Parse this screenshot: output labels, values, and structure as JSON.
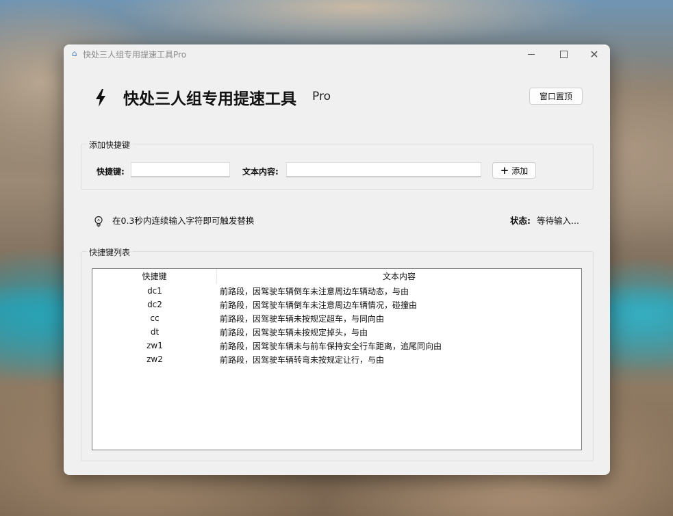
{
  "window": {
    "title": "快处三人组专用提速工具Pro"
  },
  "header": {
    "title": "快处三人组专用提速工具",
    "suffix": "Pro",
    "pin_button": "窗口置顶"
  },
  "add_group": {
    "label": "添加快捷键",
    "key_label": "快捷键:",
    "key_value": "",
    "text_label": "文本内容:",
    "text_value": "",
    "add_button": "添加"
  },
  "hint": {
    "text": "在0.3秒内连续输入字符即可触发替换",
    "status_label": "状态:",
    "status_value": "等待输入..."
  },
  "list_group": {
    "label": "快捷键列表",
    "columns": [
      "快捷键",
      "文本内容"
    ],
    "rows": [
      {
        "key": "dc1",
        "text": "前路段，因驾驶车辆倒车未注意周边车辆动态，与由"
      },
      {
        "key": "dc2",
        "text": "前路段，因驾驶车辆倒车未注意周边车辆情况，碰撞由"
      },
      {
        "key": "cc",
        "text": "前路段，因驾驶车辆未按规定超车，与同向由"
      },
      {
        "key": "dt",
        "text": "前路段，因驾驶车辆未按规定掉头，与由"
      },
      {
        "key": "zw1",
        "text": "前路段，因驾驶车辆未与前车保持安全行车距离，追尾同向由"
      },
      {
        "key": "zw2",
        "text": "前路段，因驾驶车辆转弯未按规定让行，与由"
      }
    ]
  },
  "icons": {
    "app": "app-icon",
    "bolt": "lightning-bolt-icon",
    "bulb": "lightbulb-icon",
    "plus": "plus-icon"
  }
}
